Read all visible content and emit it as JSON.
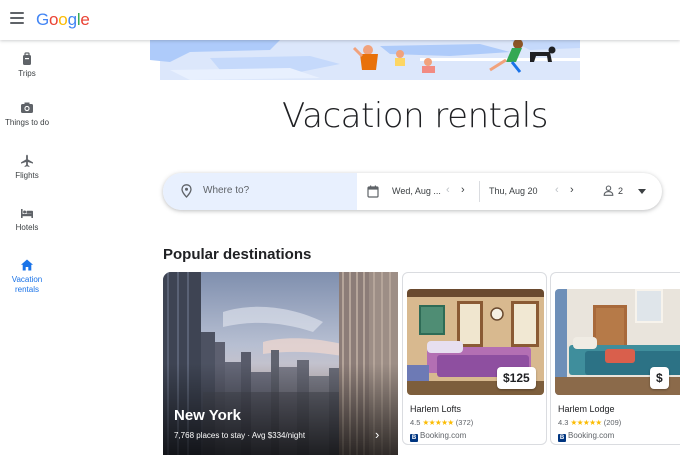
{
  "header": {
    "logo_letters": [
      {
        "ch": "G",
        "color": "#4285F4"
      },
      {
        "ch": "o",
        "color": "#EA4335"
      },
      {
        "ch": "o",
        "color": "#FBBC05"
      },
      {
        "ch": "g",
        "color": "#4285F4"
      },
      {
        "ch": "l",
        "color": "#34A853"
      },
      {
        "ch": "e",
        "color": "#EA4335"
      }
    ]
  },
  "sidebar": {
    "items": [
      {
        "label": "Trips",
        "icon": "luggage-icon",
        "active": false
      },
      {
        "label": "Things to do",
        "icon": "camera-icon",
        "active": false
      },
      {
        "label": "Flights",
        "icon": "airplane-icon",
        "active": false
      },
      {
        "label": "Hotels",
        "icon": "bed-icon",
        "active": false
      },
      {
        "label": "Vacation rentals",
        "icon": "home-icon",
        "active": true
      }
    ]
  },
  "main": {
    "title": "Vacation rentals",
    "section_title": "Popular destinations"
  },
  "search": {
    "where_placeholder": "Where to?",
    "check_in": "Wed, Aug ...",
    "check_out": "Thu, Aug 20",
    "guests": "2"
  },
  "destinations": {
    "featured": {
      "name": "New York",
      "subtitle": "7,768 places to stay · Avg $334/night"
    },
    "listings": [
      {
        "name": "Harlem Lofts",
        "price": "$125",
        "rating": "4.5",
        "stars": "★★★★★",
        "reviews": "(372)",
        "provider": "Booking.com"
      },
      {
        "name": "Harlem Lodge",
        "price": "$",
        "rating": "4.3",
        "stars": "★★★★★",
        "reviews": "(209)",
        "provider": "Booking.com"
      }
    ]
  },
  "colors": {
    "accent": "#1a73e8",
    "search_highlight": "#e8f0fe",
    "star": "#fbbc04"
  }
}
